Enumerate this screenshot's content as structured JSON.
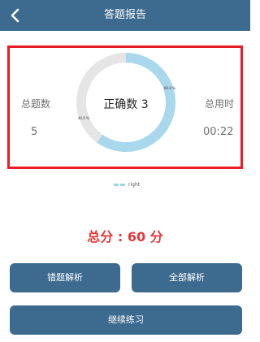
{
  "header": {
    "title": "答题报告",
    "background": "#3d6b8f",
    "back_icon": "chevron-left-icon"
  },
  "report": {
    "border_color": "#ea1d24",
    "total_questions_label": "总题数",
    "total_questions_value": "5",
    "total_time_label": "总用时",
    "total_time_value": "00:22",
    "center_label": "正确数 3"
  },
  "chart_data": {
    "type": "pie",
    "slices": [
      {
        "label": "right",
        "value": 60.0,
        "display": "60.0 %",
        "color": "#a9d8ec"
      },
      {
        "label": "",
        "value": 40.0,
        "display": "40.0 %",
        "color": "#e5e5e5"
      }
    ],
    "legend": [
      "right"
    ],
    "legend_placement": "bottom-center"
  },
  "score": {
    "text": "总分 : 60 分",
    "color": "#e23a3a"
  },
  "buttons": {
    "wrong_analysis": "错题解析",
    "all_analysis": "全部解析",
    "continue_practice": "继续练习"
  }
}
